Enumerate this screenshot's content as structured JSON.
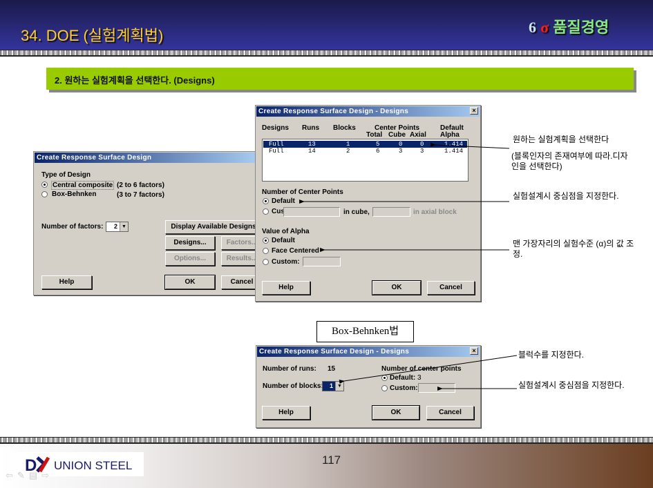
{
  "header": {
    "title": "34. DOE (실험계획법)",
    "brand_six": "6",
    "brand_sigma": "σ",
    "brand_text": "품질경영"
  },
  "section": {
    "title": "2. 원하는 실험계획을 선택한다. (Designs)"
  },
  "dialog_main": {
    "title": "Create Response Surface Design",
    "type_label": "Type of Design",
    "options": [
      {
        "label": "Central composite",
        "range": "(2 to 6 factors)",
        "selected": true
      },
      {
        "label": "Box-Behnken",
        "range": "(3 to 7 factors)",
        "selected": false
      }
    ],
    "factors_label": "Number of factors:",
    "factors_value": "2",
    "display_button": "Display Available Designs",
    "designs_button": "Designs...",
    "factors_button": "Factors...",
    "options_button": "Options...",
    "results_button": "Results...",
    "help": "Help",
    "ok": "OK",
    "cancel": "Cancel"
  },
  "dialog_designs": {
    "title": "Create Response Surface Design - Designs",
    "close": "×",
    "columns": {
      "designs": "Designs",
      "runs": "Runs",
      "blocks": "Blocks",
      "center_points": "Center Points",
      "total": "Total",
      "cube": "Cube",
      "axial": "Axial",
      "default": "Default",
      "alpha": "Alpha"
    },
    "rows": [
      {
        "design": "Full",
        "runs": "13",
        "blocks": "1",
        "total": "5",
        "cube": "0",
        "axial": "0",
        "alpha": "1.414",
        "selected": true
      },
      {
        "design": "Full",
        "runs": "14",
        "blocks": "2",
        "total": "6",
        "cube": "3",
        "axial": "3",
        "alpha": "1.414",
        "selected": false
      }
    ],
    "center_label": "Number of Center Points",
    "center_default": "Default",
    "center_custom": "Custom:",
    "in_cube": "in cube,",
    "in_axial": "in axial block",
    "alpha_label": "Value of Alpha",
    "alpha_default": "Default",
    "alpha_face": "Face Centered",
    "alpha_custom": "Custom:",
    "help": "Help",
    "ok": "OK",
    "cancel": "Cancel"
  },
  "bb_label": "Box-Behnken법",
  "dialog_bb": {
    "title": "Create Response Surface Design - Designs",
    "close": "×",
    "runs_label": "Number of runs:",
    "runs_value": "15",
    "blocks_label": "Number of blocks:",
    "blocks_value": "1",
    "center_label": "Number of center points",
    "default_label": "Default:",
    "default_value": "3",
    "custom_label": "Custom:",
    "help": "Help",
    "ok": "OK",
    "cancel": "Cancel"
  },
  "annotations": {
    "a1": "원하는 실험계획을 선택한다",
    "a1b": "(블록인자의 존재여부에 따라.디자인을 선택한다)",
    "a2": "실험설계시 중심점을 지정한다.",
    "a3": "맨 가장자리의 실험수준 (α)의 값 조정.",
    "a4": "블럭수를 지정한다.",
    "a5": "실험설계시 중심점을 지정한다."
  },
  "footer": {
    "logo": "DK UNION STEEL",
    "page": "117"
  }
}
